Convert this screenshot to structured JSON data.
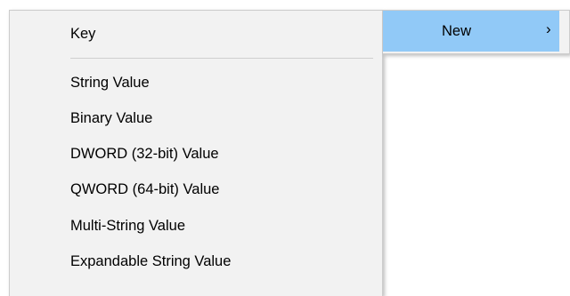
{
  "submenu": {
    "items": [
      {
        "label": "Key"
      },
      {
        "label": "String Value"
      },
      {
        "label": "Binary Value"
      },
      {
        "label": "DWORD (32-bit) Value"
      },
      {
        "label": "QWORD (64-bit) Value"
      },
      {
        "label": "Multi-String Value"
      },
      {
        "label": "Expandable String Value"
      }
    ]
  },
  "parent_menu": {
    "highlighted_item": {
      "label": "New",
      "chevron": "›",
      "icon": "chevron-right-icon"
    },
    "highlight_color": "#91c9f7"
  }
}
